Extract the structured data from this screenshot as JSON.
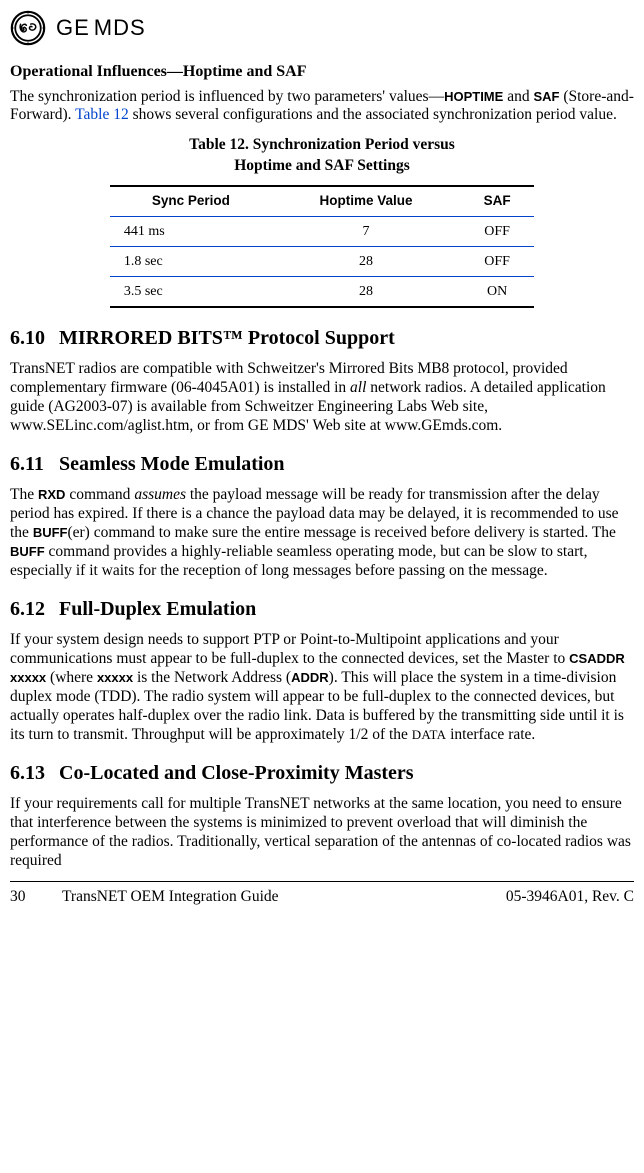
{
  "logo": {
    "brand_ge": "GE",
    "brand_mds": "MDS"
  },
  "subhead": "Operational Influences—Hoptime and SAF",
  "intro": {
    "pre": "The synchronization period is influenced by two parameters' values—",
    "hoptime": "HOPTIME",
    "and": " and ",
    "saf": "SAF",
    "saf_full": " (Store-and-Forward). ",
    "tablelink": "Table 12",
    "post": " shows several configurations and the associated synchronization period value."
  },
  "table_caption_l1": "Table 12. Synchronization Period versus",
  "table_caption_l2": "Hoptime and SAF Settings",
  "table": {
    "headers": [
      "Sync Period",
      "Hoptime Value",
      "SAF"
    ],
    "rows": [
      [
        "441 ms",
        "7",
        "OFF"
      ],
      [
        "1.8 sec",
        "28",
        "OFF"
      ],
      [
        "3.5 sec",
        "28",
        "ON"
      ]
    ]
  },
  "sec610_num": "6.10",
  "sec610_title": "MIRRORED BITS™ Protocol Support",
  "p610": {
    "pre": "TransNET radios are compatible with Schweitzer's Mirrored Bits MB8 protocol, provided complementary firmware (06-4045A01) is installed in ",
    "all": "all",
    "post": " network radios. A detailed application guide (AG2003-07) is available from Schweitzer Engineering Labs Web site, www.SELinc.com/aglist.htm, or from GE MDS' Web site at www.GEmds.com."
  },
  "sec611_num": "6.11",
  "sec611_title": "Seamless Mode Emulation",
  "p611": {
    "pre": "The ",
    "rxd": "RXD",
    "mid1": " command ",
    "assumes": "assumes",
    "mid2": " the payload message will be ready for transmission after the delay period has expired. If there is a chance the payload data may be delayed, it is recommended to use the ",
    "buff1": "BUFF",
    "er": "(er) command to make sure the entire message is received before delivery is started. The ",
    "buff2": "BUFF",
    "post": " command provides a highly-reliable seamless operating mode, but can be slow to start, especially if it waits for the reception of long messages before passing on the message."
  },
  "sec612_num": "6.12",
  "sec612_title": "Full-Duplex Emulation",
  "p612": {
    "pre": "If your system design needs to support PTP or Point-to-Multipoint applications and your communications must appear to be full-duplex to the connected devices, set the Master to ",
    "csaddr": "CSADDR xxxxx",
    "mid1": " (where ",
    "xxxxx": "xxxxx",
    "mid2": " is the Network Address (",
    "addr": "ADDR",
    "mid3": "). This will place the system in a time-division duplex mode (TDD). The radio system will appear to be full-duplex to the connected devices, but actually operates half-duplex over the radio link. Data is buffered by the transmitting side until it is its turn to transmit. Throughput will be approximately 1/2 of the ",
    "data": "DATA",
    "post": " interface rate."
  },
  "sec613_num": "6.13",
  "sec613_title": "Co-Located and Close-Proximity Masters",
  "p613": "If your requirements call for multiple TransNET networks at the same location, you need to ensure that interference between the systems is minimized to prevent overload that will diminish the performance of the radios. Traditionally, vertical separation of the antennas of co-located radios was required",
  "footer": {
    "page": "30",
    "title": "TransNET OEM Integration Guide",
    "docnum": "05-3946A01, Rev. C"
  }
}
